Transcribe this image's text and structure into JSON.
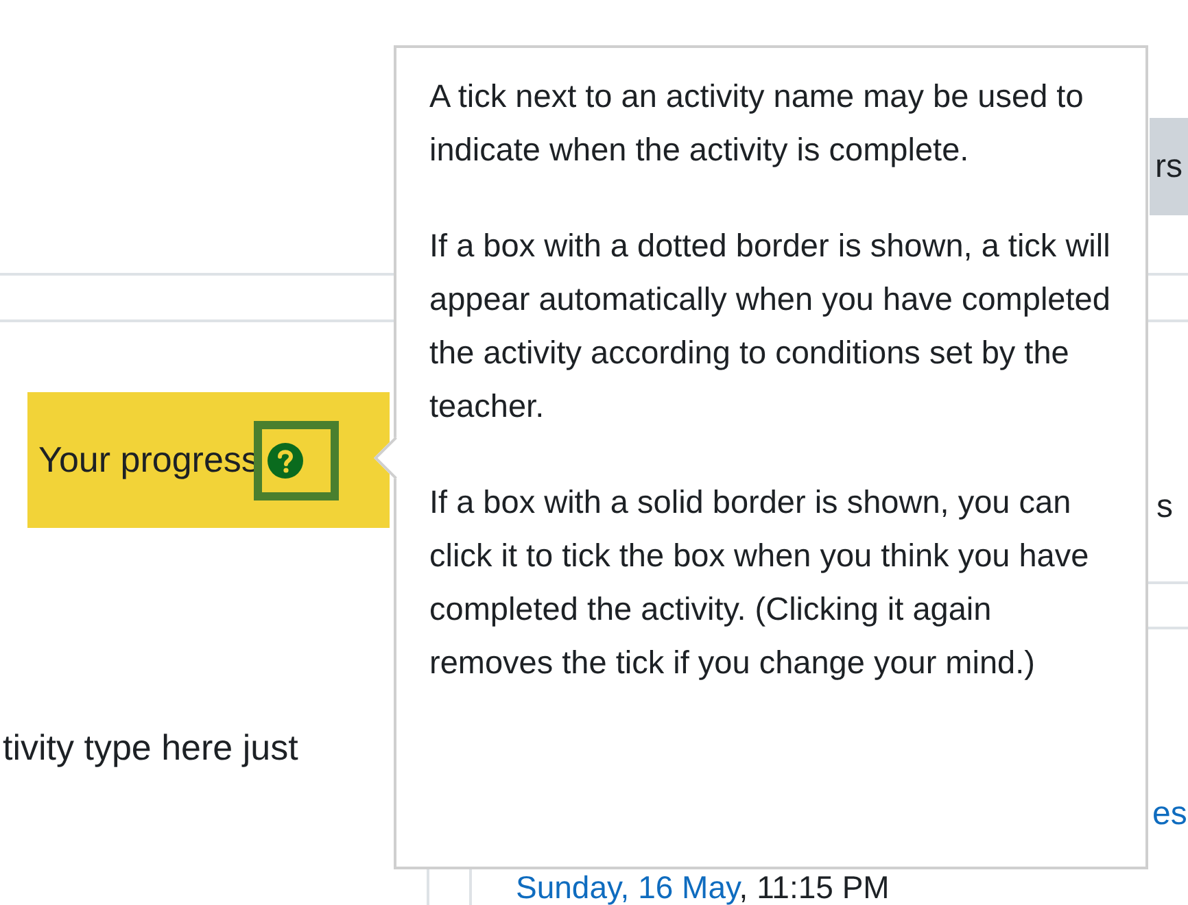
{
  "background": {
    "button_fragment": "rs",
    "side_fragment": "s",
    "description_fragment": "tivity type here just",
    "link_fragment": "es",
    "date_link": "Sunday, 16 May",
    "date_rest": ", 11:15 PM"
  },
  "progress": {
    "label": "Your progress",
    "help_focused": true
  },
  "popover": {
    "paragraphs": [
      "A tick next to an activity name may be used to indicate when the activity is complete.",
      "If a box with a dotted border is shown, a tick will appear automatically when you have completed the activity according to conditions set by the teacher.",
      "If a box with a solid border is shown, you can click it to tick the box when you think you have completed the activity. (Clicking it again removes the tick if you change your mind.)"
    ]
  }
}
